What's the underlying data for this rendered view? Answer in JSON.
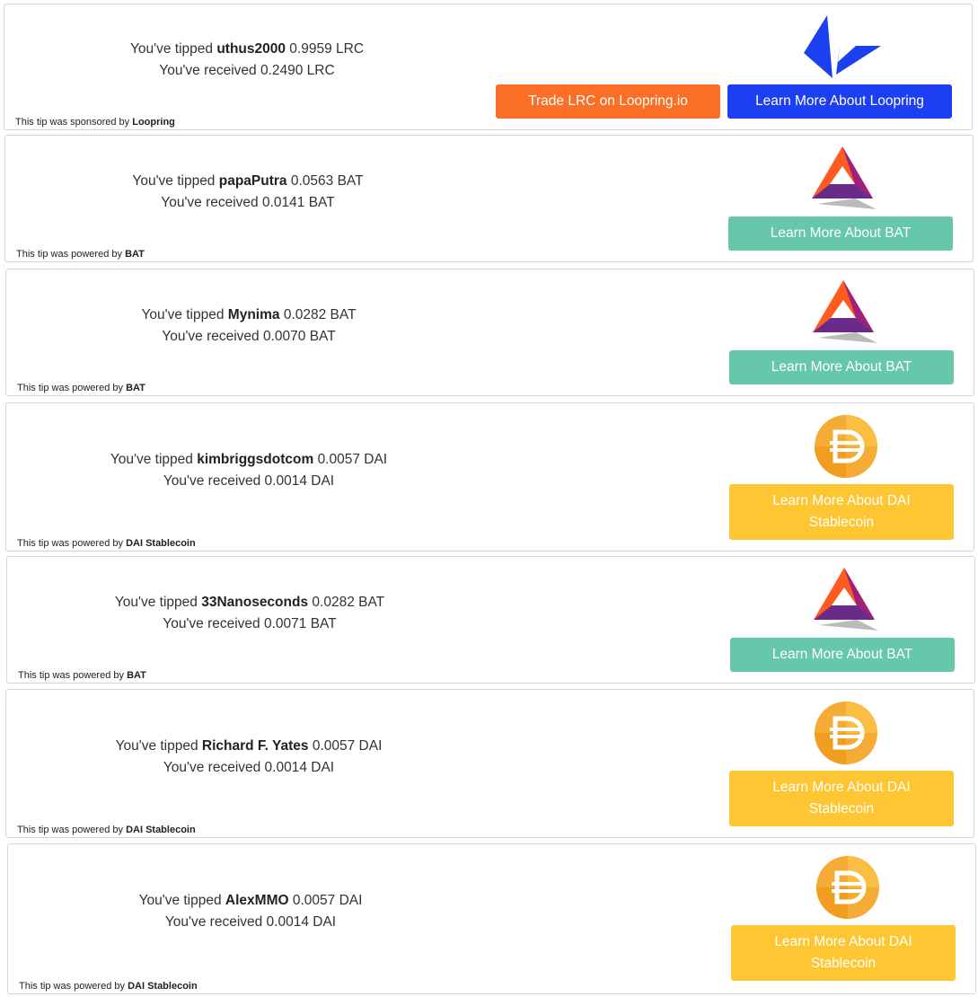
{
  "colors": {
    "loopring_trade": "#fb6e26",
    "loopring_learn": "#1d3ff2",
    "bat_button": "#66c7ab",
    "dai_button": "#ffc634"
  },
  "cards": [
    {
      "tipped_prefix": "You've tipped",
      "user": "uthus2000",
      "tipped_amount": "0.9959 LRC",
      "received": "You've received 0.2490 LRC",
      "footer_prefix": "This tip was sponsored by",
      "footer_brand": "Loopring",
      "logo": "loopring-logo",
      "buttons": [
        "Trade LRC on Loopring.io",
        "Learn More About Loopring"
      ]
    },
    {
      "tipped_prefix": "You've tipped",
      "user": "papaPutra",
      "tipped_amount": "0.0563 BAT",
      "received": "You've received 0.0141 BAT",
      "footer_prefix": "This tip was powered by",
      "footer_brand": "BAT",
      "logo": "bat-logo",
      "buttons": [
        "Learn More About BAT"
      ]
    },
    {
      "tipped_prefix": "You've tipped",
      "user": "Mynima",
      "tipped_amount": "0.0282 BAT",
      "received": "You've received 0.0070 BAT",
      "footer_prefix": "This tip was powered by",
      "footer_brand": "BAT",
      "logo": "bat-logo",
      "buttons": [
        "Learn More About BAT"
      ]
    },
    {
      "tipped_prefix": "You've tipped",
      "user": "kimbriggsdotcom",
      "tipped_amount": "0.0057 DAI",
      "received": "You've received 0.0014 DAI",
      "footer_prefix": "This tip was powered by",
      "footer_brand": "DAI Stablecoin",
      "logo": "dai-logo",
      "buttons": [
        "Learn More About DAI Stablecoin"
      ]
    },
    {
      "tipped_prefix": "You've tipped",
      "user": "33Nanoseconds",
      "tipped_amount": "0.0282 BAT",
      "received": "You've received 0.0071 BAT",
      "footer_prefix": "This tip was powered by",
      "footer_brand": "BAT",
      "logo": "bat-logo",
      "buttons": [
        "Learn More About BAT"
      ]
    },
    {
      "tipped_prefix": "You've tipped",
      "user": "Richard F. Yates",
      "tipped_amount": "0.0057 DAI",
      "received": "You've received 0.0014 DAI",
      "footer_prefix": "This tip was powered by",
      "footer_brand": "DAI Stablecoin",
      "logo": "dai-logo",
      "buttons": [
        "Learn More About DAI Stablecoin"
      ]
    },
    {
      "tipped_prefix": "You've tipped",
      "user": "AlexMMO",
      "tipped_amount": "0.0057 DAI",
      "received": "You've received 0.0014 DAI",
      "footer_prefix": "This tip was powered by",
      "footer_brand": "DAI Stablecoin",
      "logo": "dai-logo",
      "buttons": [
        "Learn More About DAI Stablecoin"
      ]
    }
  ]
}
